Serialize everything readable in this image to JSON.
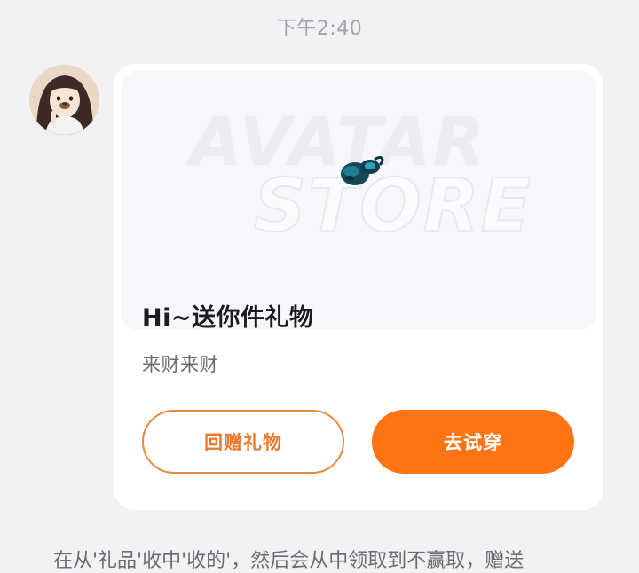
{
  "chat": {
    "timestamp": "下午2:40",
    "bottom_text": "在从'礼品'收中'收的'，然后会从中领取到不赢取，赠送"
  },
  "gift_card": {
    "banner": {
      "line1": "AVATAR",
      "line2": "STORE",
      "item_icon": "pacifier-icon"
    },
    "title": "Hi~送你件礼物",
    "subtitle": "来财来财",
    "gift_back_label": "回赠礼物",
    "try_on_label": "去试穿"
  },
  "colors": {
    "accent": "#fd7513",
    "outline": "#e98a3c",
    "page_bg": "#f2f2f4",
    "card_bg": "#ffffff"
  }
}
